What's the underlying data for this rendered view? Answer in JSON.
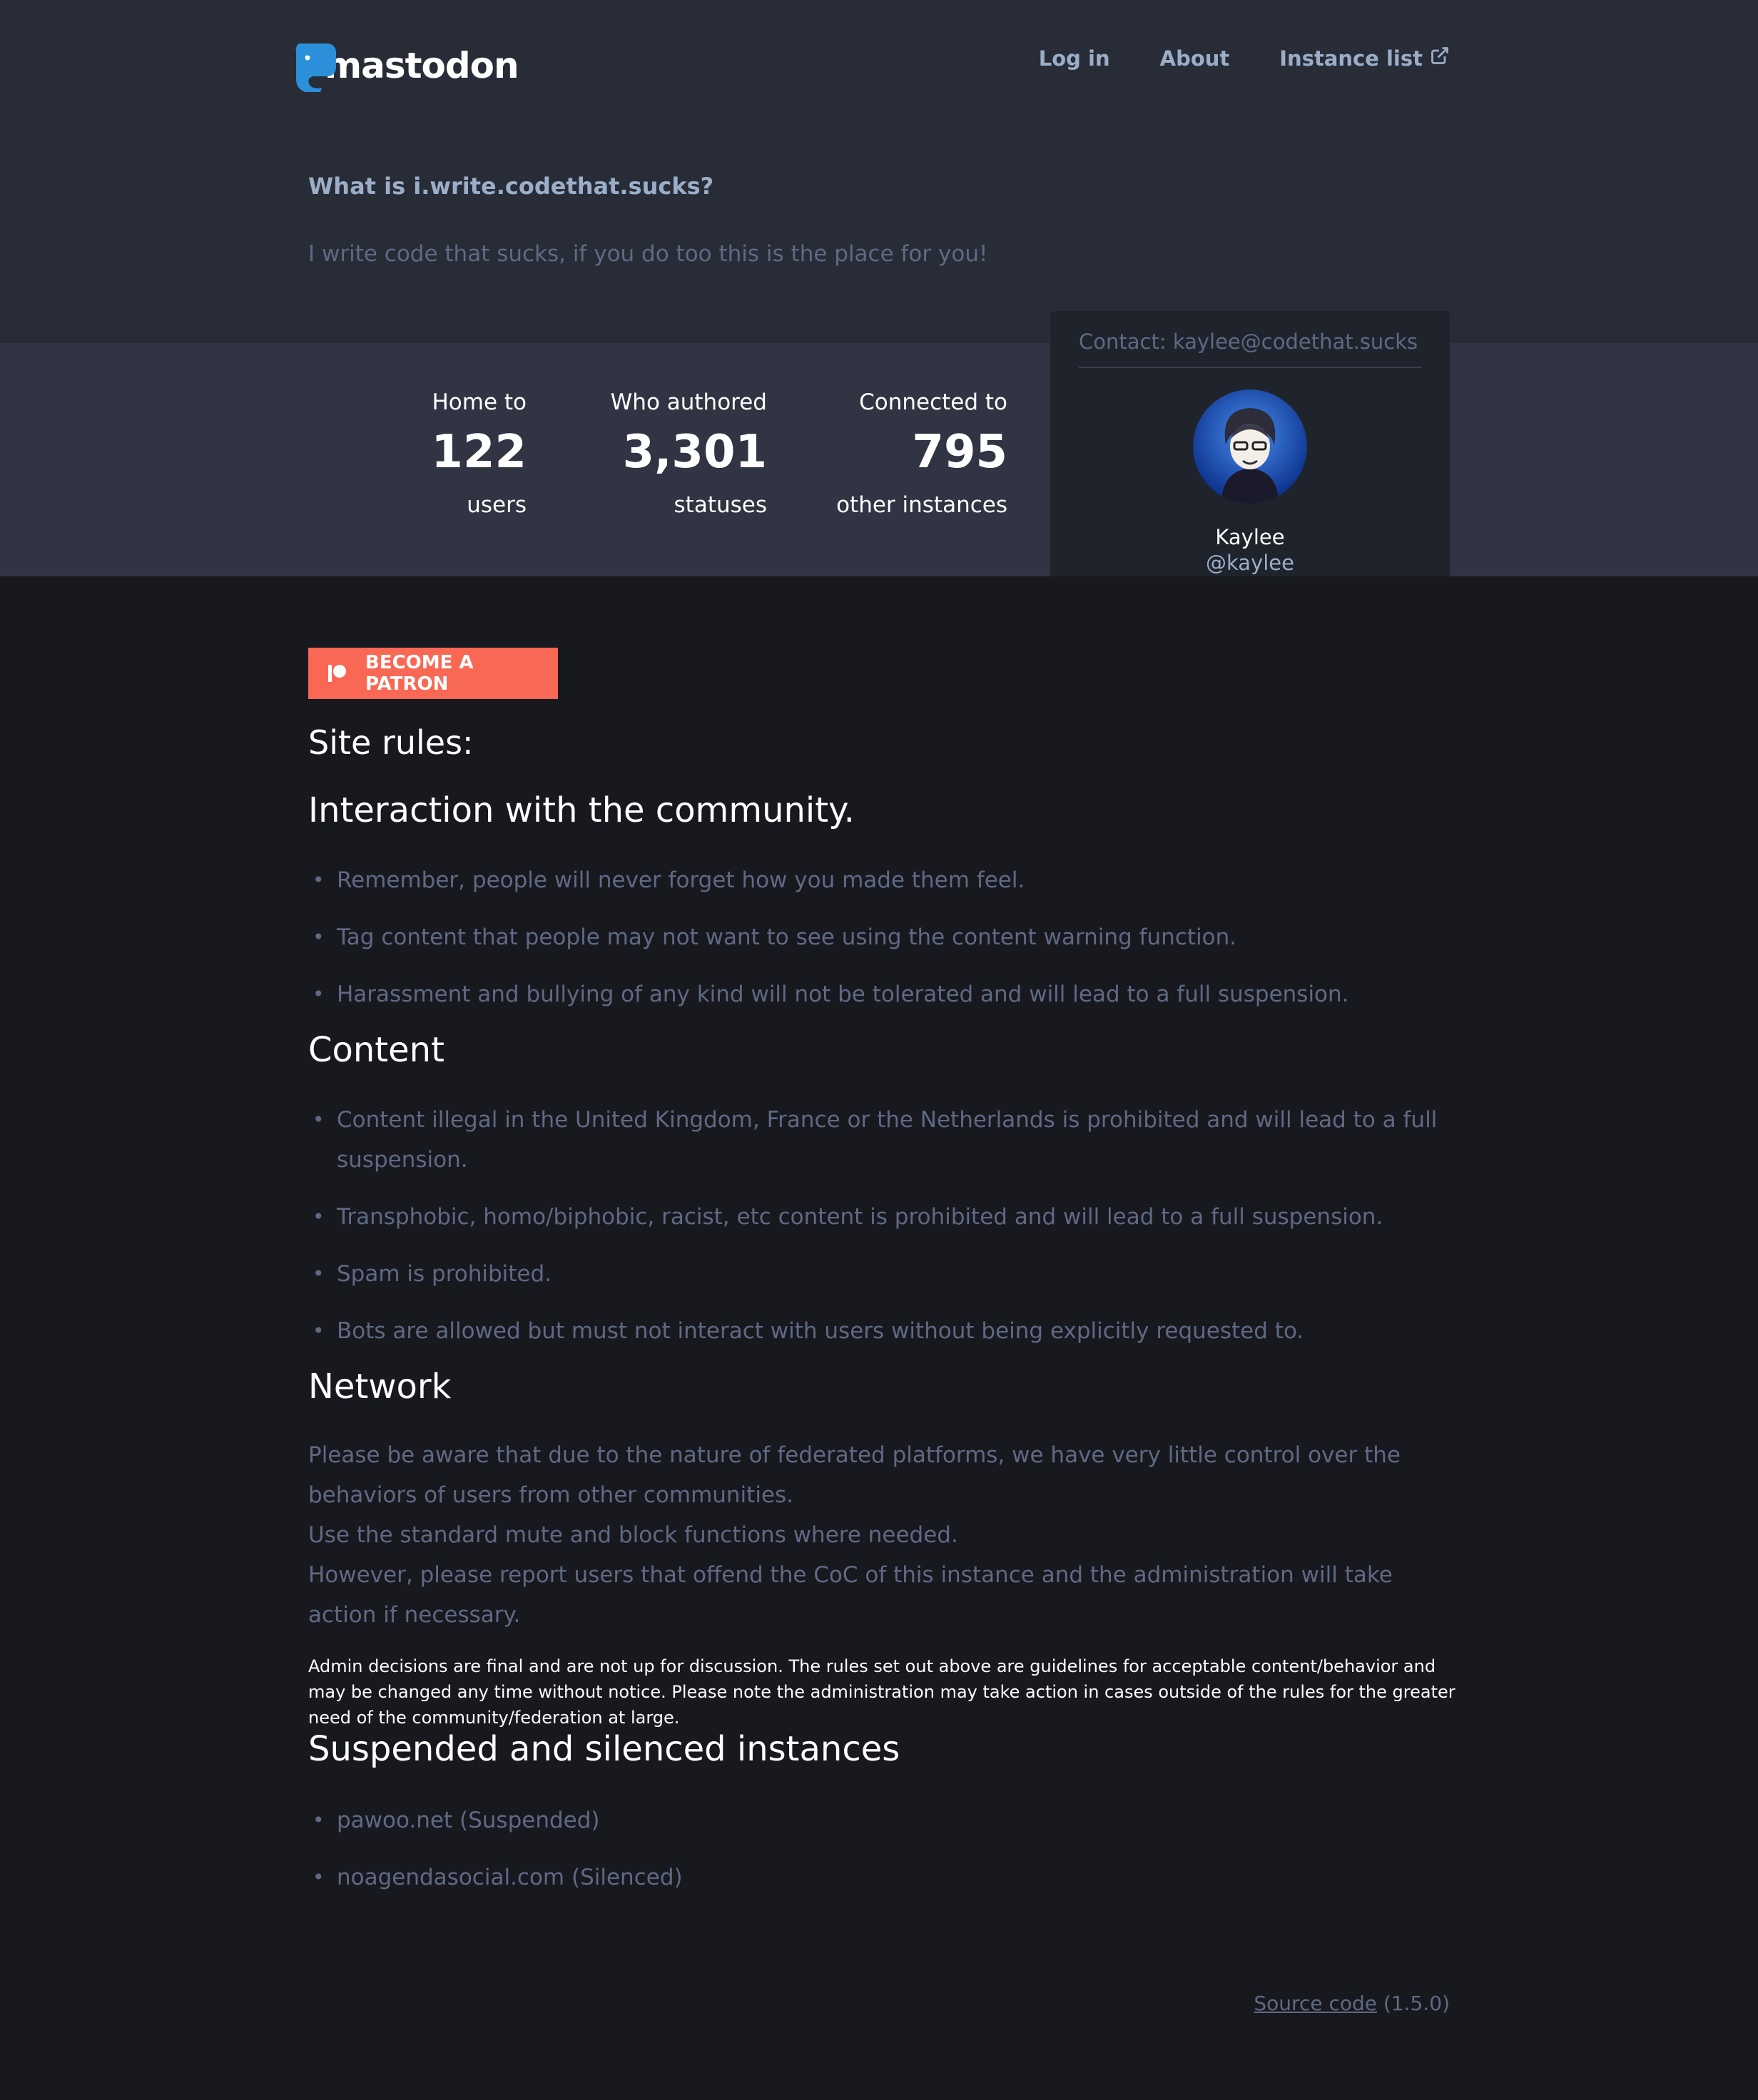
{
  "brand": {
    "name": "mastodon",
    "accent": "#2b90d9"
  },
  "nav": {
    "login": "Log in",
    "about": "About",
    "instance_list": "Instance list",
    "instance_list_icon": "external-link-icon"
  },
  "hero": {
    "title": "What is i.write.codethat.sucks?",
    "description": "I write code that sucks, if you do too this is the place for you!"
  },
  "stats": [
    {
      "label": "Home to",
      "value": "122",
      "unit": "users"
    },
    {
      "label": "Who authored",
      "value": "3,301",
      "unit": "statuses"
    },
    {
      "label": "Connected to",
      "value": "795",
      "unit": "other instances"
    }
  ],
  "contact": {
    "heading": "Contact: kaylee@codethat.sucks",
    "display_name": "Kaylee",
    "handle": "@kaylee"
  },
  "patron": {
    "label": "BECOME A PATRON",
    "color": "#f96854"
  },
  "rules": {
    "heading": "Site rules:",
    "sections": [
      {
        "title": "Interaction with the community.",
        "items": [
          "Remember, people will never forget how you made them feel.",
          "Tag content that people may not want to see using the content warning function.",
          "Harassment and bullying of any kind will not be tolerated and will lead to a full suspension."
        ]
      },
      {
        "title": "Content",
        "items": [
          "Content illegal in the United Kingdom, France or the Netherlands is prohibited and will lead to a full suspension.",
          "Transphobic, homo/biphobic, racist, etc content is prohibited and will lead to a full suspension.",
          "Spam is prohibited.",
          "Bots are allowed but must not interact with users without being explicitly requested to."
        ]
      }
    ],
    "network": {
      "title": "Network",
      "lines": [
        "Please be aware that due to the nature of federated platforms, we have very little control over the behaviors of users from other communities.",
        "Use the standard mute and block functions where needed.",
        "However, please report users that offend the CoC of this instance and the administration will take action if necessary."
      ]
    },
    "admin_note": "Admin decisions are final and are not up for discussion. The rules set out above are guidelines for acceptable content/behavior and may be changed any time without notice. Please note the administration may take action in cases outside of the rules for the greater need of the community/federation at large.",
    "instances": {
      "title": "Suspended and silenced instances",
      "items": [
        "pawoo.net (Suspended)",
        "noagendasocial.com (Silenced)"
      ]
    }
  },
  "footer": {
    "source_link": "Source code",
    "version": "(1.5.0)"
  }
}
